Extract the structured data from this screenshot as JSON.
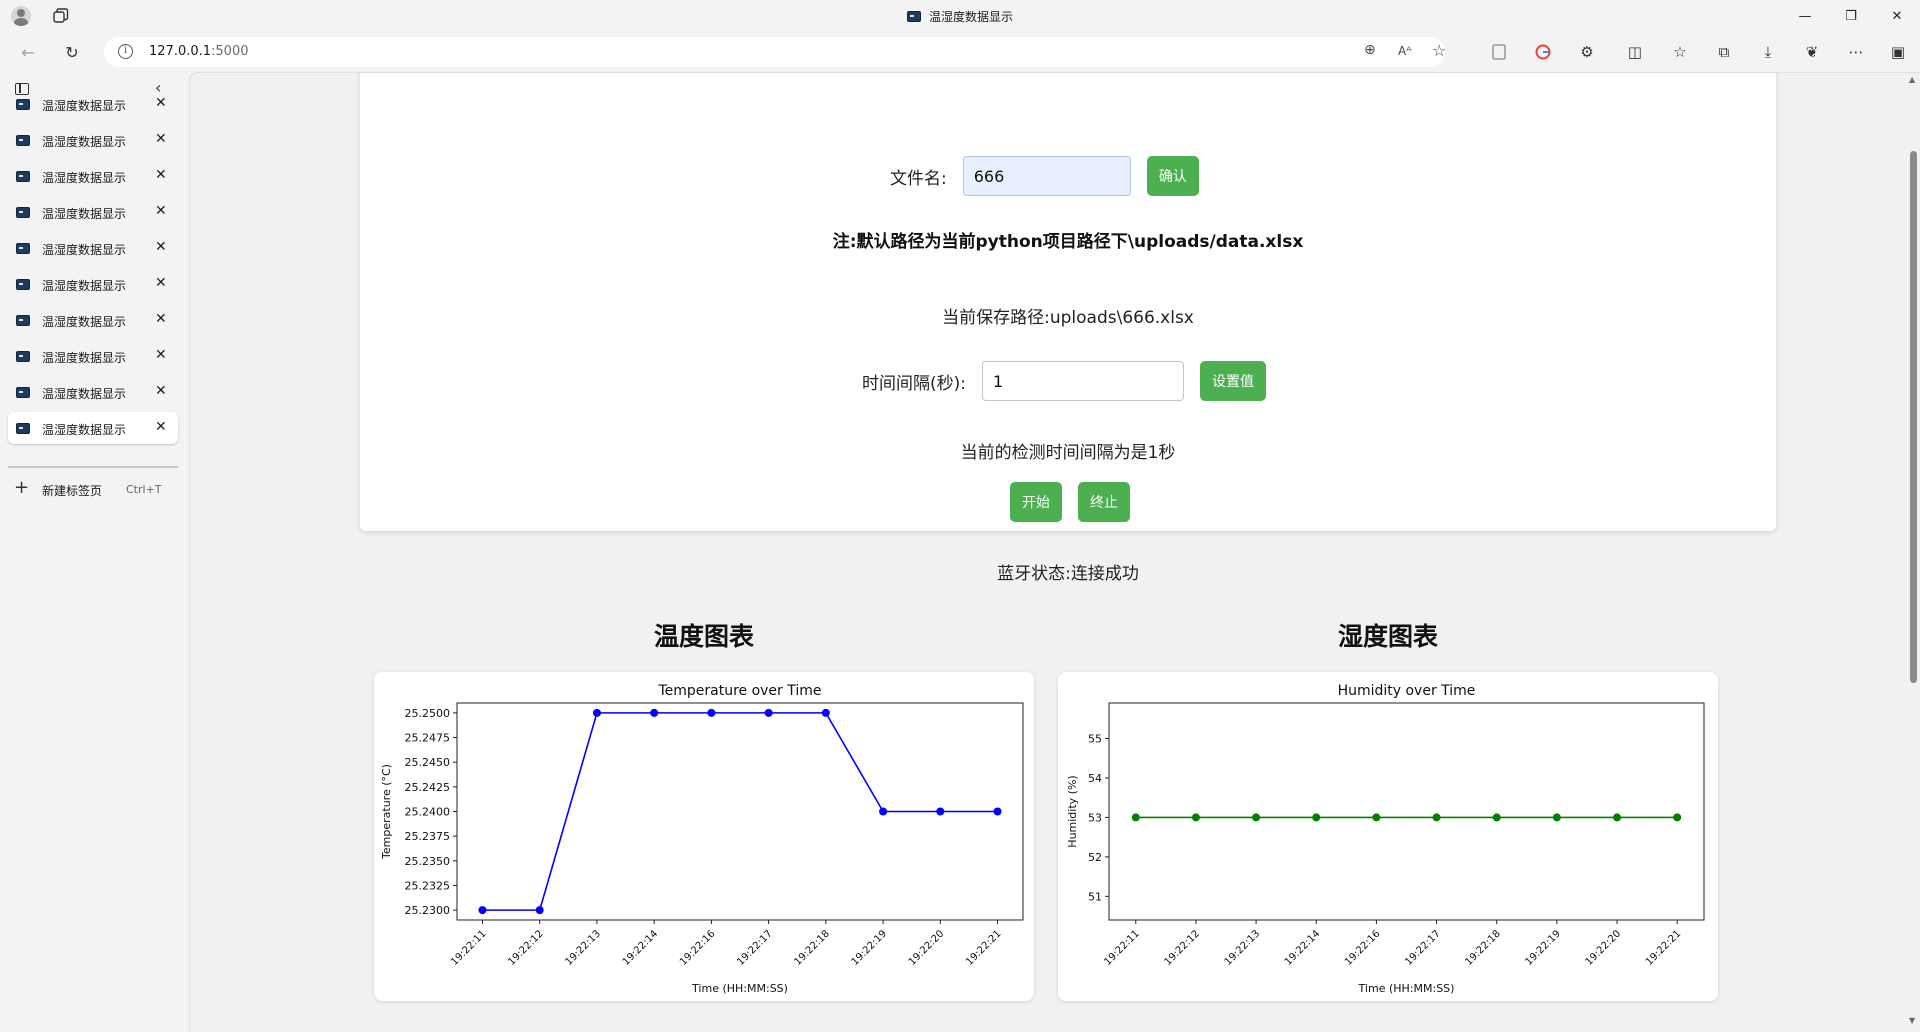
{
  "browser": {
    "window_title": "温湿度数据显示",
    "url_host": "127.0.0.1",
    "url_port": ":5000",
    "tabs": [
      {
        "label": "温湿度数据显示",
        "active": false
      },
      {
        "label": "温湿度数据显示",
        "active": false
      },
      {
        "label": "温湿度数据显示",
        "active": false
      },
      {
        "label": "温湿度数据显示",
        "active": false
      },
      {
        "label": "温湿度数据显示",
        "active": false
      },
      {
        "label": "温湿度数据显示",
        "active": false
      },
      {
        "label": "温湿度数据显示",
        "active": false
      },
      {
        "label": "温湿度数据显示",
        "active": false
      },
      {
        "label": "温湿度数据显示",
        "active": false
      },
      {
        "label": "温湿度数据显示",
        "active": true
      }
    ],
    "new_tab_label": "新建标签页",
    "new_tab_shortcut": "Ctrl+T"
  },
  "page": {
    "filename_label": "文件名:",
    "filename_value": "666",
    "confirm_button": "确认",
    "note": "注:默认路径为当前python项目路径下\\uploads/data.xlsx",
    "save_path": "当前保存路径:uploads\\666.xlsx",
    "interval_label": "时间间隔(秒):",
    "interval_value": "1",
    "set_button": "设置值",
    "interval_status": "当前的检测时间间隔为是1秒",
    "start_button": "开始",
    "stop_button": "终止",
    "bluetooth_status": "蓝牙状态:连接成功",
    "temp_section_title": "温度图表",
    "humid_section_title": "湿度图表"
  },
  "colors": {
    "button_green": "#4caf50",
    "temp_line": "#0000ff",
    "humid_line": "#008000"
  },
  "chart_data": [
    {
      "type": "line",
      "title": "Temperature over Time",
      "xlabel": "Time (HH:MM:SS)",
      "ylabel": "Temperature (°C)",
      "categories": [
        "19:22:11",
        "19:22:12",
        "19:22:13",
        "19:22:14",
        "19:22:16",
        "19:22:17",
        "19:22:18",
        "19:22:19",
        "19:22:20",
        "19:22:21"
      ],
      "series": [
        {
          "values": [
            25.23,
            25.23,
            25.25,
            25.25,
            25.25,
            25.25,
            25.25,
            25.24,
            25.24,
            25.24
          ]
        }
      ],
      "ylim": [
        25.229,
        25.251
      ],
      "yticks": [
        "25.2300",
        "25.2325",
        "25.2350",
        "25.2375",
        "25.2400",
        "25.2425",
        "25.2450",
        "25.2475",
        "25.2500"
      ],
      "ytick_values": [
        25.23,
        25.2325,
        25.235,
        25.2375,
        25.24,
        25.2425,
        25.245,
        25.2475,
        25.25
      ],
      "grid": false,
      "color": "#0000ff"
    },
    {
      "type": "line",
      "title": "Humidity over Time",
      "xlabel": "Time (HH:MM:SS)",
      "ylabel": "Humidity (%)",
      "categories": [
        "19:22:11",
        "19:22:12",
        "19:22:13",
        "19:22:14",
        "19:22:16",
        "19:22:17",
        "19:22:18",
        "19:22:19",
        "19:22:20",
        "19:22:21"
      ],
      "series": [
        {
          "values": [
            53,
            53,
            53,
            53,
            53,
            53,
            53,
            53,
            53,
            53
          ]
        }
      ],
      "ylim": [
        50.4,
        55.9
      ],
      "yticks": [
        "51",
        "52",
        "53",
        "54",
        "55"
      ],
      "ytick_values": [
        51,
        52,
        53,
        54,
        55
      ],
      "grid": false,
      "color": "#008000"
    }
  ]
}
